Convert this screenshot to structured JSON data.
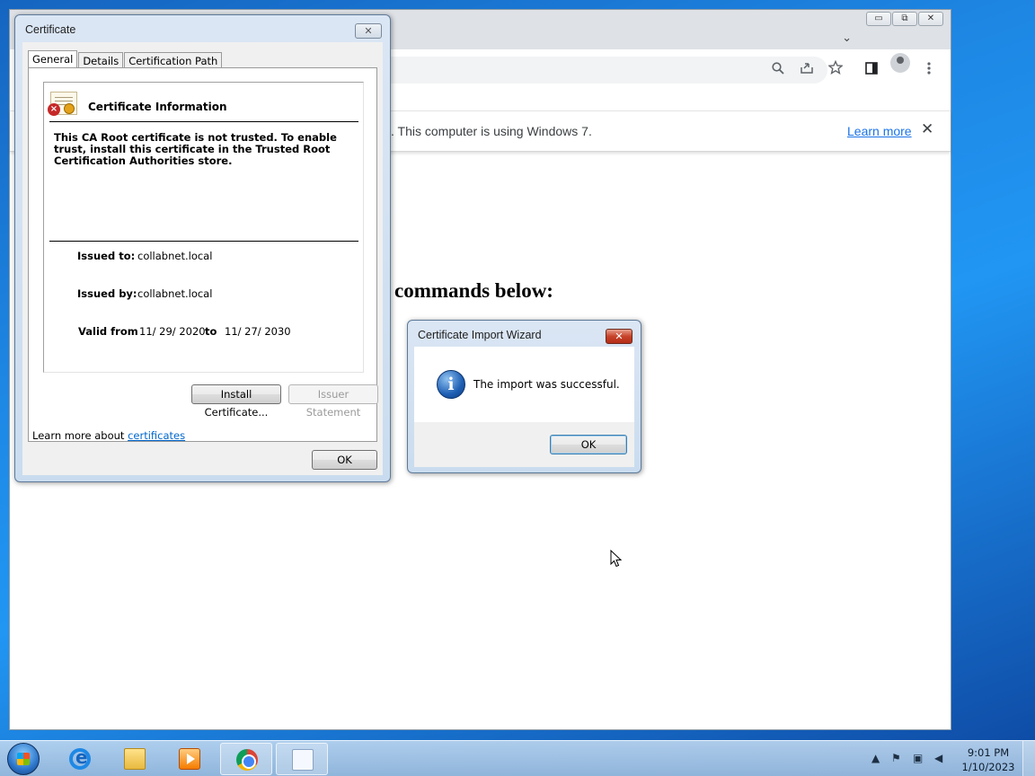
{
  "browser": {
    "window_controls": {
      "minimize": "▭",
      "maximize": "⧉",
      "close": "✕"
    },
    "tab_dropdown": "⌄",
    "toolbar_icons": [
      "search-icon",
      "share-icon",
      "star-icon",
      "side-panel-icon",
      "profile-icon",
      "menu-icon"
    ],
    "infobar": {
      "text": ". This computer is using Windows 7.",
      "link": "Learn more",
      "close": "✕"
    },
    "page_heading": "commands below:"
  },
  "certificate_dialog": {
    "title": "Certificate",
    "close": "✕",
    "tabs": [
      {
        "label": "General",
        "active": true
      },
      {
        "label": "Details",
        "active": false
      },
      {
        "label": "Certification Path",
        "active": false
      }
    ],
    "info_heading": "Certificate Information",
    "message": "This CA Root certificate is not trusted. To enable trust, install this certificate in the Trusted Root Certification Authorities store.",
    "issued_to_label": "Issued to:",
    "issued_to": "collabnet.local",
    "issued_by_label": "Issued by:",
    "issued_by": "collabnet.local",
    "valid_from_label": "Valid from",
    "valid_from": "11/ 29/ 2020",
    "to_label": "to",
    "valid_to": "11/ 27/ 2030",
    "install_button": "Install Certificate...",
    "issuer_statement_button": "Issuer Statement",
    "learn_more_prefix": "Learn more about ",
    "learn_more_link": "certificates",
    "ok_button": "OK"
  },
  "import_wizard": {
    "title": "Certificate Import Wizard",
    "close": "✕",
    "message": "The import was successful.",
    "ok_button": "OK"
  },
  "taskbar": {
    "apps": [
      "internet-explorer",
      "windows-explorer",
      "media-player",
      "google-chrome",
      "notepad"
    ],
    "time": "9:01 PM",
    "date": "1/10/2023",
    "tray_icons": [
      "show-hidden-icons",
      "action-center-flag",
      "network-icon",
      "volume-muted-icon"
    ]
  },
  "colors": {
    "link_blue": "#1a73e8",
    "dialog_frame": "#c9dcef",
    "close_red": "#c7432a"
  }
}
